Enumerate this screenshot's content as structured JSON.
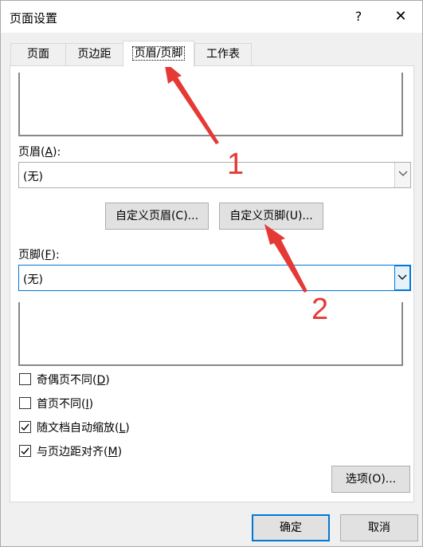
{
  "dialog": {
    "title": "页面设置",
    "help_label": "?",
    "close_label": "✕"
  },
  "tabs": [
    {
      "label": "页面",
      "active": false
    },
    {
      "label": "页边距",
      "active": false
    },
    {
      "label": "页眉/页脚",
      "active": true
    },
    {
      "label": "工作表",
      "active": false
    }
  ],
  "header": {
    "label_prefix": "页眉(",
    "label_key": "A",
    "label_suffix": "):",
    "value": "(无)",
    "custom_button": "自定义页眉(C)..."
  },
  "footer": {
    "label_prefix": "页脚(",
    "label_key": "F",
    "label_suffix": "):",
    "value": "(无)",
    "custom_button": "自定义页脚(U)..."
  },
  "options": [
    {
      "label_text": "奇偶页不同(",
      "key": "D",
      "suffix": ")",
      "checked": false
    },
    {
      "label_text": "首页不同(",
      "key": "I",
      "suffix": ")",
      "checked": false
    },
    {
      "label_text": "随文档自动缩放(",
      "key": "L",
      "suffix": ")",
      "checked": true
    },
    {
      "label_text": "与页边距对齐(",
      "key": "M",
      "suffix": ")",
      "checked": true
    }
  ],
  "buttons": {
    "options": "选项(O)...",
    "ok": "确定",
    "cancel": "取消"
  },
  "annotations": {
    "num1": "1",
    "num2": "2",
    "color": "#e53935"
  },
  "icons": {
    "dropdown": "chevron-down-icon",
    "check": "checkmark-icon"
  }
}
